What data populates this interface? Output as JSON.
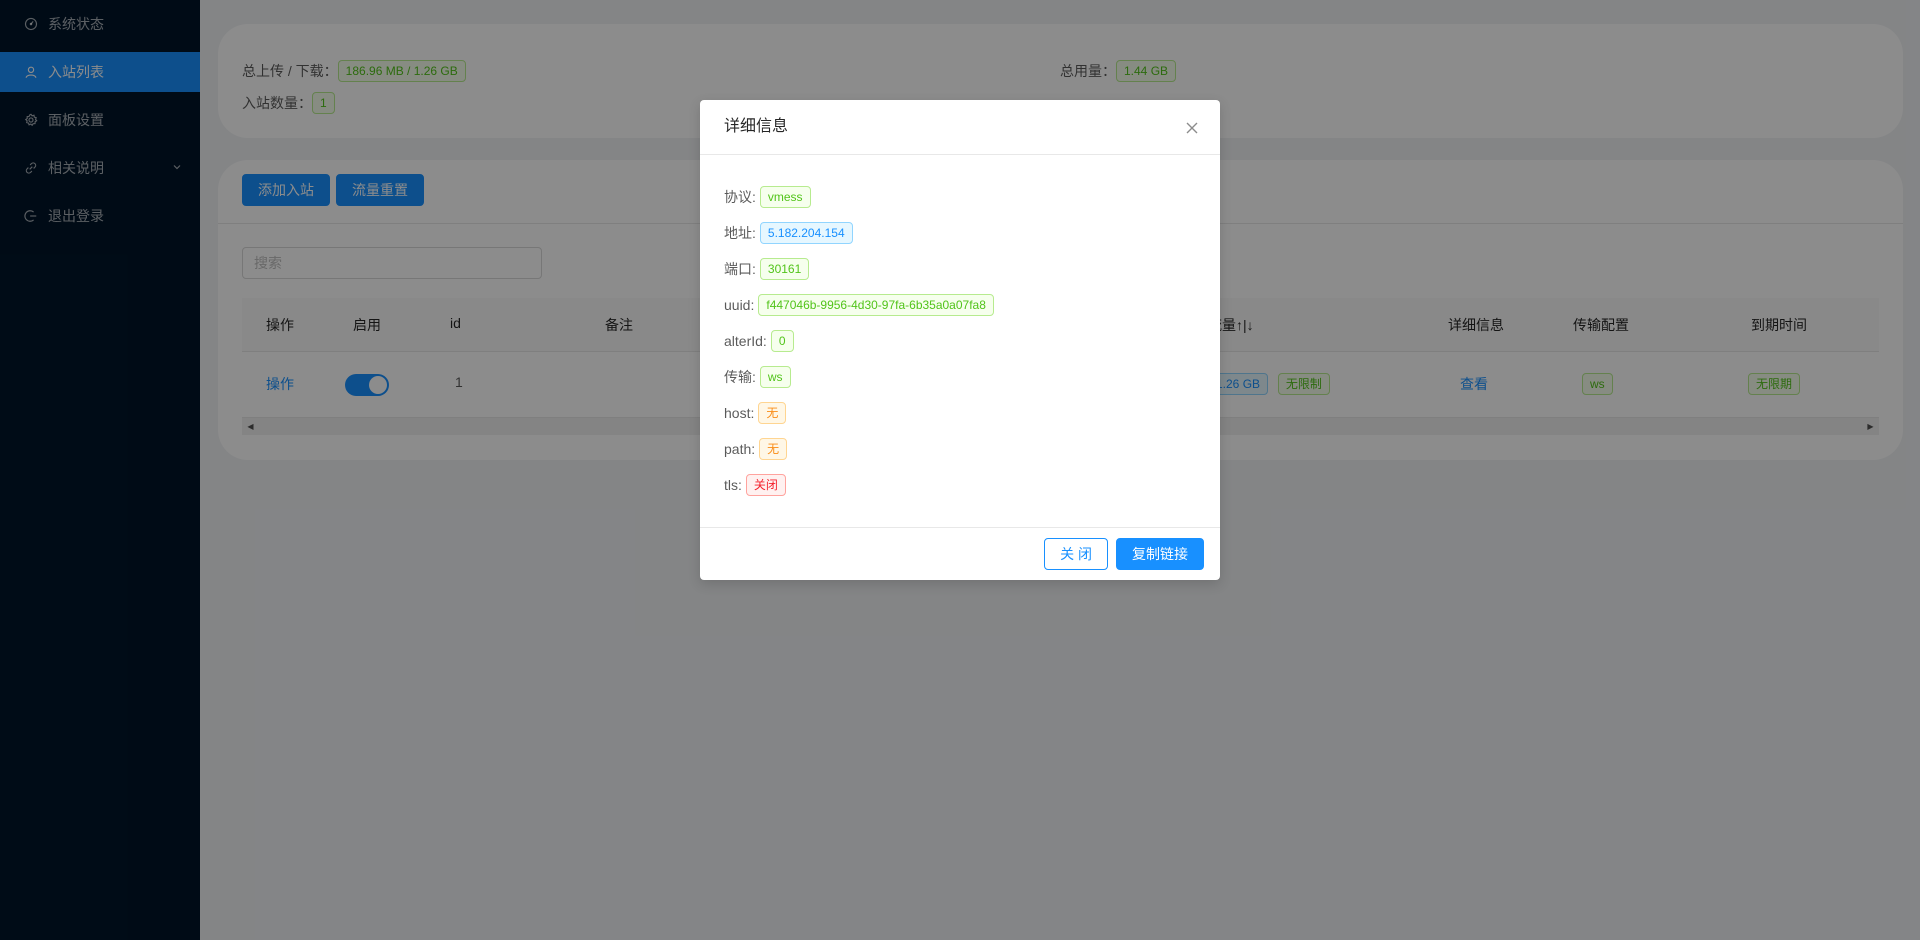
{
  "sidebar": {
    "items": [
      {
        "label": "系统状态",
        "icon": "dashboard-icon"
      },
      {
        "label": "入站列表",
        "icon": "user-icon"
      },
      {
        "label": "面板设置",
        "icon": "setting-icon"
      },
      {
        "label": "相关说明",
        "icon": "link-icon"
      },
      {
        "label": "退出登录",
        "icon": "logout-icon"
      }
    ]
  },
  "stats": {
    "upload_download_label": "总上传 / 下载：",
    "upload_download_value": "186.96 MB / 1.26 GB",
    "total_usage_label": "总用量：",
    "total_usage_value": "1.44 GB",
    "inbound_count_label": "入站数量：",
    "inbound_count_value": "1"
  },
  "toolbar": {
    "add_inbound": "添加入站",
    "reset_traffic": "流量重置",
    "search_placeholder": "搜索"
  },
  "table": {
    "columns": [
      "操作",
      "启用",
      "id",
      "备注",
      "流量↑|↓",
      "详细信息",
      "传输配置",
      "到期时间"
    ],
    "row": {
      "action": "操作",
      "id": "1",
      "traffic_partial": "1.26 GB",
      "traffic_limit": "无限制",
      "detail": "查看",
      "transport": "ws",
      "expiry": "无限期"
    }
  },
  "modal": {
    "title": "详细信息",
    "rows": [
      {
        "label": "协议:",
        "value": "vmess",
        "color": "green"
      },
      {
        "label": "地址:",
        "value": "5.182.204.154",
        "color": "blue"
      },
      {
        "label": "端口:",
        "value": "30161",
        "color": "green"
      },
      {
        "label": "uuid:",
        "value": "f447046b-9956-4d30-97fa-6b35a0a07fa8",
        "color": "green"
      },
      {
        "label": "alterId:",
        "value": "0",
        "color": "green"
      },
      {
        "label": "传输:",
        "value": "ws",
        "color": "green"
      },
      {
        "label": "host:",
        "value": "无",
        "color": "orange"
      },
      {
        "label": "path:",
        "value": "无",
        "color": "orange"
      },
      {
        "label": "tls:",
        "value": "关闭",
        "color": "red"
      }
    ],
    "close_button": "关 闭",
    "copy_button": "复制链接"
  }
}
